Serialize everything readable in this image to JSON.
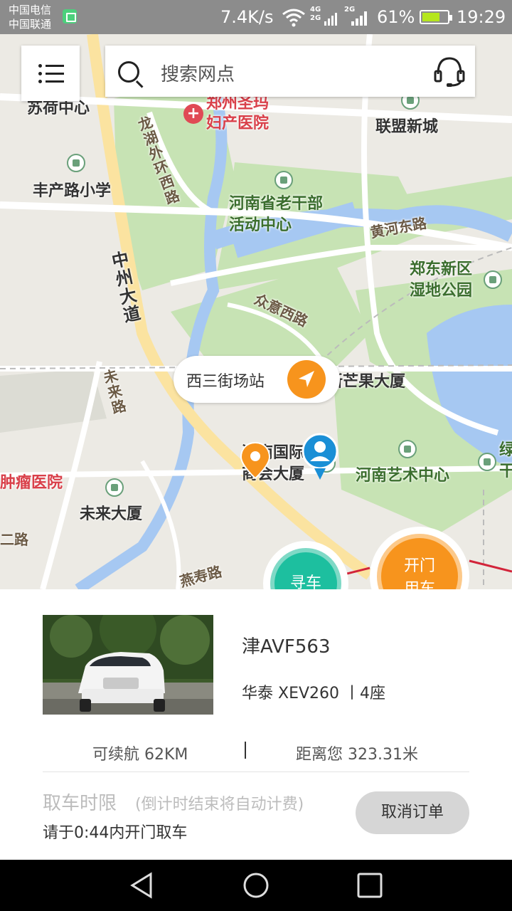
{
  "status_bar": {
    "carriers": [
      "中国电信",
      "中国联通"
    ],
    "net_speed": "7.4K/s",
    "signal_labels": [
      "4G",
      "2G",
      "2G"
    ],
    "battery": "61%",
    "time": "19:29"
  },
  "search": {
    "placeholder": "搜索网点"
  },
  "map": {
    "labels": {
      "top_left_partial": "苏荷中心",
      "hospital": "郑州圣玛\n妇产医院",
      "lianmeng": "联盟新城",
      "fengchan": "丰产路小学",
      "longhu": "龙湖外环西路",
      "laoganbu": "河南省老干部\n活动中心",
      "huanghe": "黄河东路",
      "zhengdong": "郑东新区\n湿地公园",
      "zhongzhou": "中州大道",
      "zhongyi": "众意西路",
      "mango": "新芒果大厦",
      "weilai_road": "未来路",
      "chamber": "河南国际\n商会大厦",
      "art_center": "河南艺术中心",
      "tumor": "肿瘤医院",
      "weilai_building": "未来大厦",
      "yanshou": "燕寿路",
      "partial_road": "二路",
      "partial_right": "绿\n干"
    },
    "station_name": "西三街场站"
  },
  "buttons": {
    "find_car": "寻车",
    "open_car": "开门\n用车",
    "cancel_order": "取消订单"
  },
  "car": {
    "plate": "津AVF563",
    "model": "华泰 XEV260 丨4座",
    "range": "可续航  62KM",
    "distance": "距离您 323.31米"
  },
  "pickup": {
    "title": "取车时限",
    "note": "(倒计时结束将自动计费)",
    "instruction": "请于0:44内开门取车"
  },
  "colors": {
    "accent_orange": "#f7941d",
    "accent_green": "#1dbf9f",
    "map_park": "#c7e3b4",
    "map_water": "#a6c8f2"
  }
}
